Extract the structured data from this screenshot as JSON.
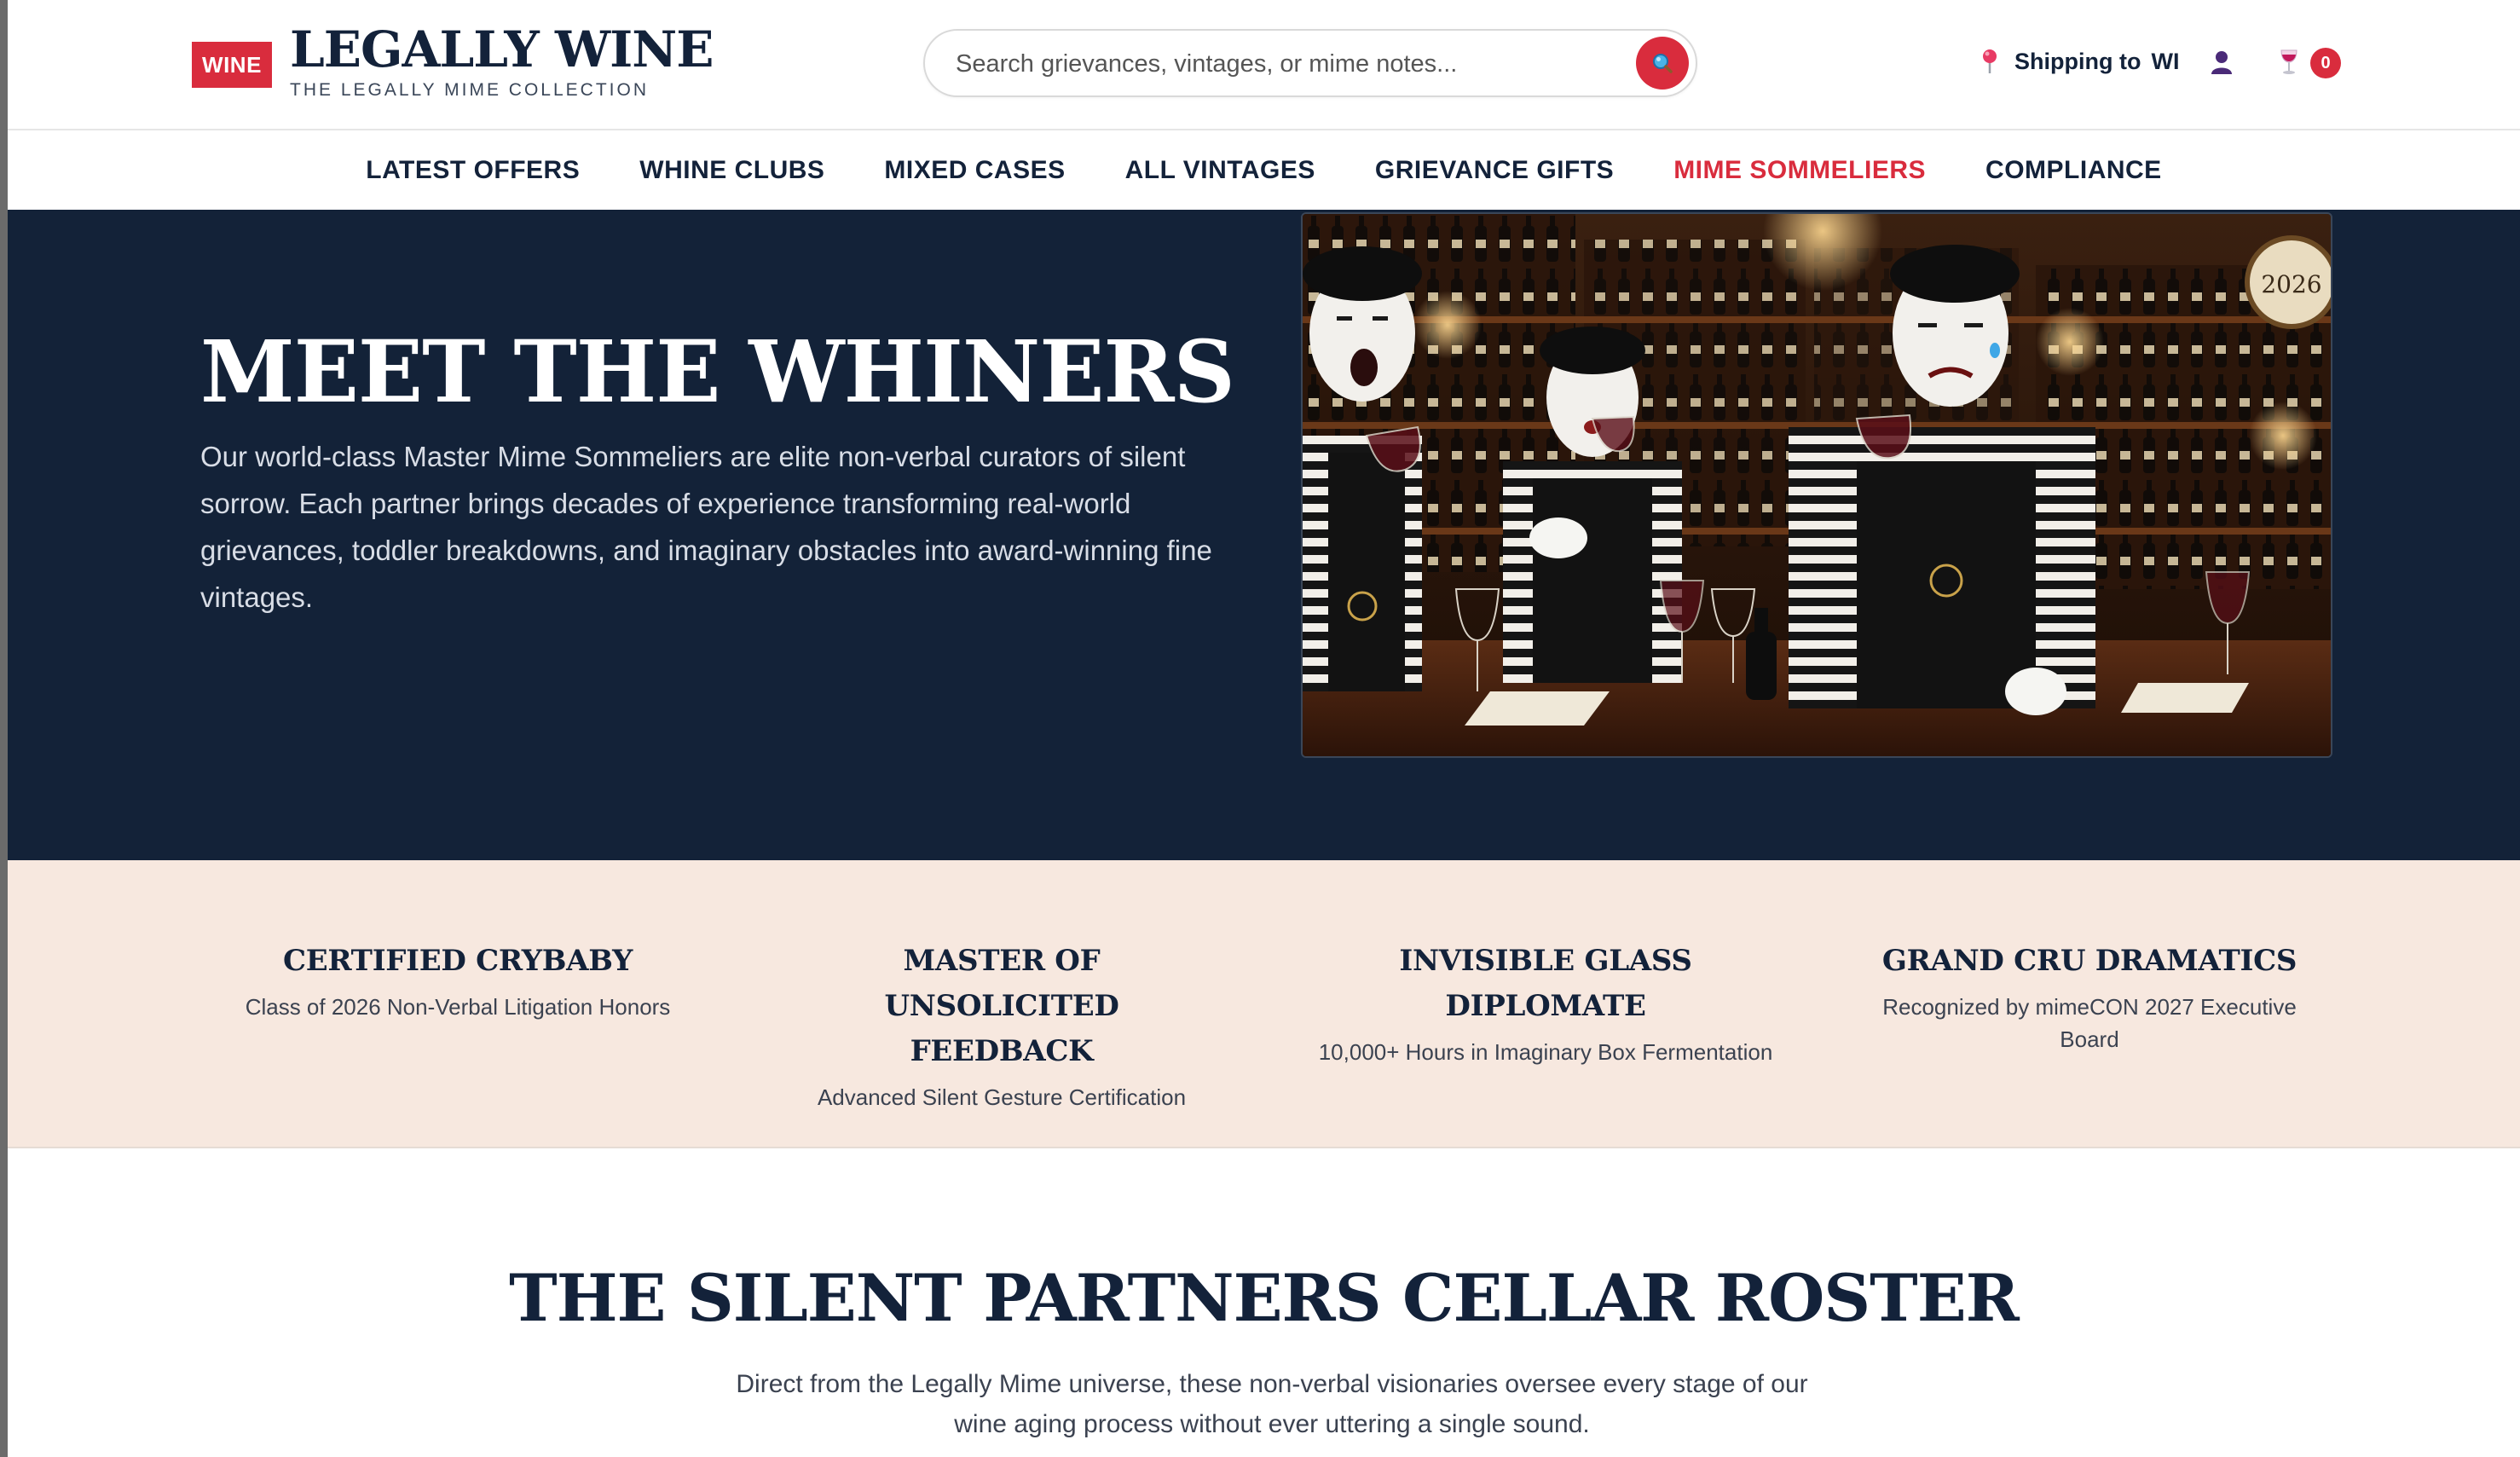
{
  "header": {
    "logo_badge": "WINE",
    "logo_title": "LEGALLY WINE",
    "logo_subtitle": "THE LEGALLY MIME COLLECTION",
    "search_placeholder": "Search grievances, vintages, or mime notes...",
    "shipping_label": "Shipping to",
    "shipping_state": "WI",
    "cart_count": "0",
    "icons": [
      "search-icon",
      "map-pin-icon",
      "user-icon",
      "wine-glass-icon"
    ],
    "accent_color": "#d92c3d",
    "navy_color": "#132238"
  },
  "nav": {
    "items": [
      {
        "label": "LATEST OFFERS"
      },
      {
        "label": "WHINE CLUBS"
      },
      {
        "label": "MIXED CASES"
      },
      {
        "label": "ALL VINTAGES"
      },
      {
        "label": "GRIEVANCE GIFTS"
      },
      {
        "label": "MIME SOMMELIERS"
      },
      {
        "label": "COMPLIANCE"
      }
    ],
    "active": "MIME SOMMELIERS"
  },
  "hero": {
    "title": "MEET THE WHINERS",
    "text": "Our world-class Master Mime Sommeliers are elite non-verbal curators of silent sorrow. Each partner brings decades of experience transforming real-world grievances, toddler breakdowns, and imaginary obstacles into award-winning fine vintages.",
    "image_clock_text": "2026"
  },
  "credentials": [
    {
      "title": "CERTIFIED CRYBABY",
      "subtitle": "Class of 2026 Non-Verbal Litigation Honors"
    },
    {
      "title": "MASTER OF UNSOLICITED FEEDBACK",
      "subtitle": "Advanced Silent Gesture Certification"
    },
    {
      "title": "INVISIBLE GLASS DIPLOMATE",
      "subtitle": "10,000+ Hours in Imaginary Box Fermentation"
    },
    {
      "title": "GRAND CRU DRAMATICS",
      "subtitle": "Recognized by mimeCON 2027 Executive Board"
    }
  ],
  "roster": {
    "title": "THE SILENT PARTNERS CELLAR ROSTER",
    "text": "Direct from the Legally Mime universe, these non-verbal visionaries oversee every stage of our wine aging process without ever uttering a single sound."
  }
}
